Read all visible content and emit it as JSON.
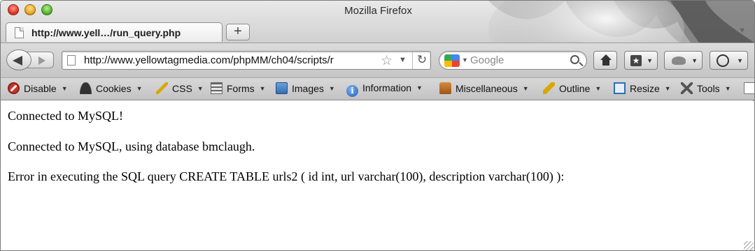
{
  "window": {
    "title": "Mozilla Firefox"
  },
  "tab": {
    "title": "http://www.yell…/run_query.php",
    "new_tab_label": "+"
  },
  "navigation": {
    "url": "http://www.yellowtagmedia.com/phpMM/ch04/scripts/r",
    "search_placeholder": "Google"
  },
  "devbar": {
    "items": [
      {
        "label": "Disable",
        "icon": "disable-icon"
      },
      {
        "label": "Cookies",
        "icon": "cookies-icon"
      },
      {
        "label": "CSS",
        "icon": "css-icon"
      },
      {
        "label": "Forms",
        "icon": "forms-icon"
      },
      {
        "label": "Images",
        "icon": "images-icon"
      },
      {
        "label": "Information",
        "icon": "information-icon"
      },
      {
        "label": "Miscellaneous",
        "icon": "miscellaneous-icon"
      },
      {
        "label": "Outline",
        "icon": "outline-icon"
      },
      {
        "label": "Resize",
        "icon": "resize-icon"
      },
      {
        "label": "Tools",
        "icon": "tools-icon"
      }
    ]
  },
  "page": {
    "lines": [
      "Connected to MySQL!",
      "Connected to MySQL, using database bmclaugh.",
      "Error in executing the SQL query CREATE TABLE urls2 ( id int, url varchar(100), description varchar(100) ):"
    ]
  }
}
